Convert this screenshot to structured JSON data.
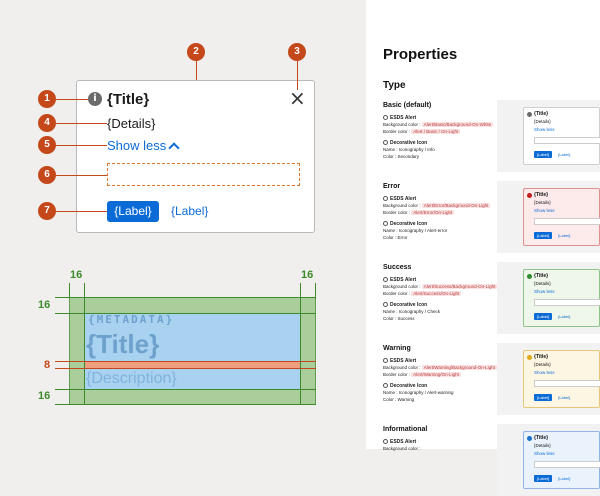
{
  "anatomy": {
    "title": "{Title}",
    "details": "{Details}",
    "show_less": "Show less",
    "primary_label": "{Label}",
    "secondary_label": "{Label}",
    "info_glyph": "i",
    "close_glyph": "×",
    "markers": [
      "1",
      "2",
      "3",
      "4",
      "5",
      "6",
      "7"
    ]
  },
  "spacing": {
    "metadata": "{METADATA}",
    "title": "{Title}",
    "description": "{Description}",
    "top_left": "16",
    "top_right": "16",
    "pad_top": "16",
    "gap": "8",
    "pad_bottom": "16"
  },
  "properties": {
    "heading": "Properties",
    "type_heading": "Type",
    "sections": [
      {
        "name": "Basic (default)",
        "alert_label": "ESDS Alert",
        "bg_label": "Background color :",
        "bg_token": "Alert/Basic/Background-On-White",
        "border_label": "Border color :",
        "border_token": "Alert / Basic / On-Light",
        "icon_label": "Decorative Icon",
        "icon_name": "Name : Iconography / Info",
        "icon_color": "Color : Secondary",
        "accent": "#6b6b6b",
        "bg": "#ffffff",
        "border": "#cfcfcf"
      },
      {
        "name": "Error",
        "alert_label": "ESDS Alert",
        "bg_label": "Background color :",
        "bg_token": "Alert/Error/Background-On-Light",
        "border_label": "Border color :",
        "border_token": "Alert/Error/On-Light",
        "icon_label": "Decorative Icon",
        "icon_name": "Name : Iconography / Alert-error",
        "icon_color": "Color : Error",
        "accent": "#c41e1e",
        "bg": "#fdeaea",
        "border": "#e09090"
      },
      {
        "name": "Success",
        "alert_label": "ESDS Alert",
        "bg_label": "Background color :",
        "bg_token": "Alert/Success/Background-On-Light",
        "border_label": "Border color :",
        "border_token": "Alert/Success/On-Light",
        "icon_label": "Decorative Icon",
        "icon_name": "Name : Iconography / Check",
        "icon_color": "Color : Success",
        "accent": "#2e8b2e",
        "bg": "#eef7ea",
        "border": "#8fc58a"
      },
      {
        "name": "Warning",
        "alert_label": "ESDS Alert",
        "bg_label": "Background color :",
        "bg_token": "Alert/Warning/Background-On-Light",
        "border_label": "Border color :",
        "border_token": "Alert/Warning/On-Light",
        "icon_label": "Decorative Icon",
        "icon_name": "Name : Iconography / Alert-warning",
        "icon_color": "Color : Warning",
        "accent": "#e0a81a",
        "bg": "#fdf6e2",
        "border": "#e7c87a"
      },
      {
        "name": "Informational",
        "alert_label": "ESDS Alert",
        "bg_label": "Background color :",
        "bg_token": "",
        "border_label": "",
        "border_token": "",
        "icon_label": "",
        "icon_name": "",
        "icon_color": "",
        "accent": "#1a6fd0",
        "bg": "#eaf2fc",
        "border": "#8fb4e5"
      }
    ],
    "mini_title": "{Title}",
    "mini_details": "{Details}",
    "mini_show": "Show less",
    "mini_label": "{Label}"
  }
}
